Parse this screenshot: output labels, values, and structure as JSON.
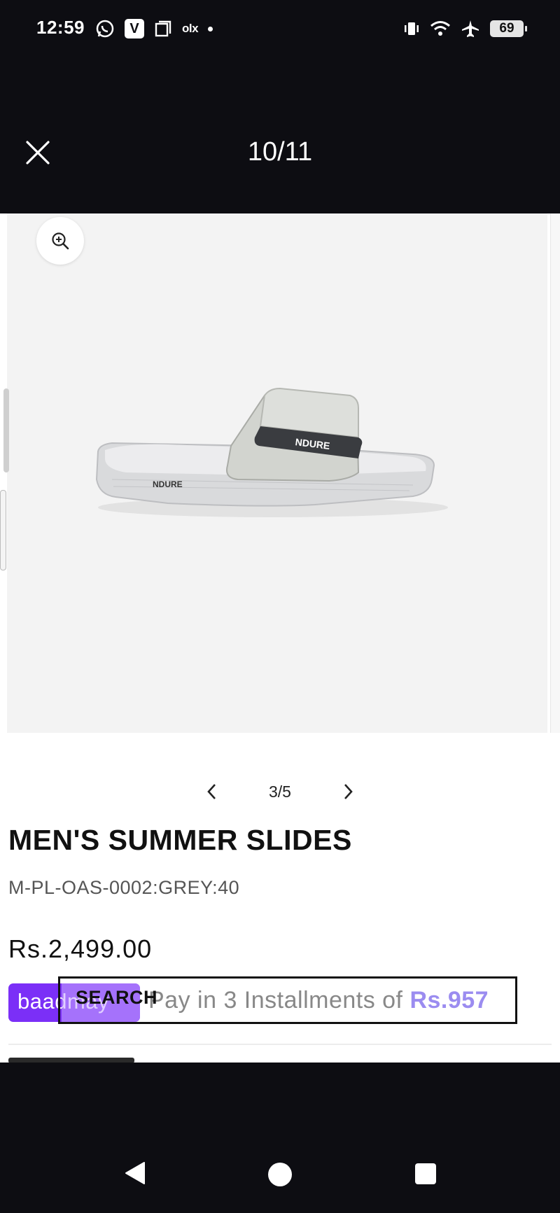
{
  "status_bar": {
    "time": "12:59",
    "left_icons": [
      "whatsapp-icon",
      "v-app-icon",
      "copy-icon",
      "olx-icon",
      "dot-icon"
    ],
    "v_label": "V",
    "olx_label": "olx",
    "right_icons": [
      "vibrate-icon",
      "wifi-icon",
      "airplane-icon",
      "battery-icon"
    ],
    "battery_level": "69"
  },
  "viewer": {
    "counter": "10/11",
    "close_icon": "close-icon"
  },
  "product": {
    "brand_mark": "NDURE",
    "gallery_counter": "3/5",
    "title": "MEN'S SUMMER SLIDES",
    "sku": "M-PL-OAS-0002:GREY:40",
    "price": "Rs.2,499.00",
    "bnpl_logo": "baadmay",
    "installment_prefix": "Pay in 3 Installments of ",
    "installment_amount": "Rs.957",
    "search_overlay_label": "SEARCH"
  },
  "colors": {
    "background_dark": "#0d0d12",
    "bnpl_purple": "#7b2ff7",
    "installment_accent": "#9b8cf0"
  },
  "nav_bar": {
    "icons": [
      "back-icon",
      "home-icon",
      "recents-icon"
    ]
  }
}
